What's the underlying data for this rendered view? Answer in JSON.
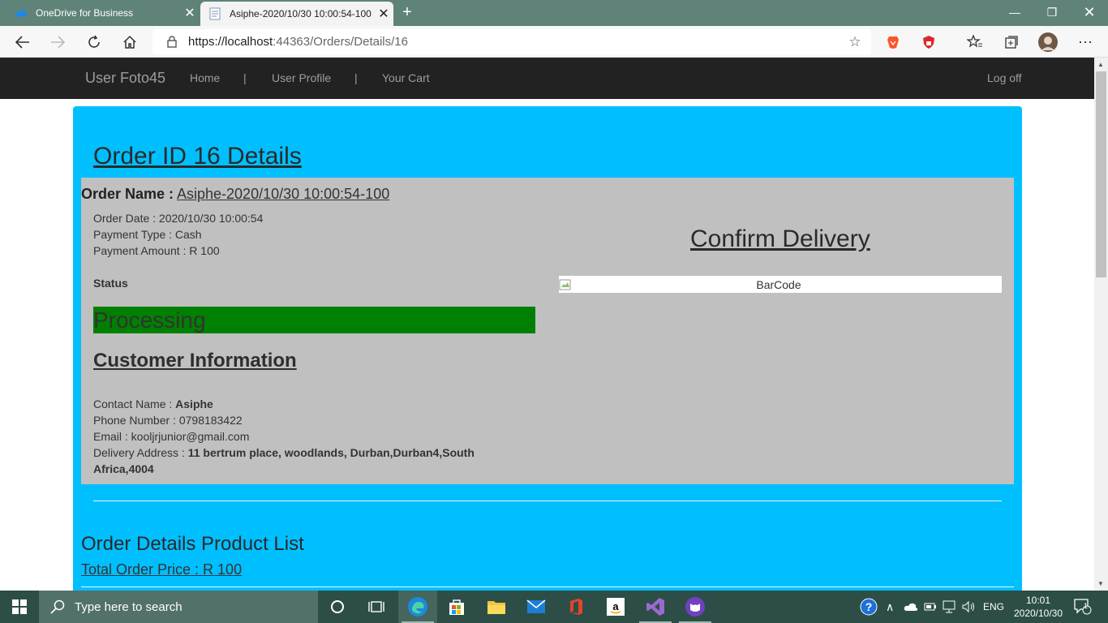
{
  "browser": {
    "tabs": [
      {
        "label": "OneDrive for Business",
        "active": false
      },
      {
        "label": "Asiphe-2020/10/30 10:00:54-100",
        "active": true
      }
    ],
    "url_prefix": "https://localhost",
    "url_rest": ":44363/Orders/Details/16"
  },
  "site_nav": {
    "brand": "User Foto45",
    "home": "Home",
    "sep1": "|",
    "profile": "User Profile",
    "sep2": "|",
    "cart": "Your Cart",
    "logoff": "Log off"
  },
  "order": {
    "title": "Order ID 16 Details",
    "name_label": "Order Name :",
    "name_value": "Asiphe-2020/10/30 10:00:54-100",
    "date": "Order Date : 2020/10/30 10:00:54",
    "payment_type": "Payment Type : Cash",
    "payment_amount": "Payment Amount : R 100",
    "status_label": "Status",
    "status_value": "Processing",
    "confirm_delivery": "Confirm Delivery",
    "barcode_alt": "BarCode"
  },
  "customer": {
    "title": "Customer Information",
    "contact_label": "Contact Name : ",
    "contact_value": "Asiphe",
    "phone": "Phone Number : 0798183422",
    "email": "Email : kooljrjunior@gmail.com",
    "address_label": "Delivery Address : ",
    "address_line1": "11 bertrum place, woodlands, Durban,Durban4,South",
    "address_line2": "Africa,4004"
  },
  "products": {
    "title": "Order Details Product List",
    "total": "Total Order Price : R 100"
  },
  "taskbar": {
    "search_placeholder": "Type here to search",
    "lang": "ENG",
    "time": "10:01",
    "date": "2020/10/30",
    "notification_count": "1"
  },
  "colors": {
    "panel": "#00bfff",
    "status_bar": "#008000",
    "navbar": "#222222",
    "gray_box": "#c0c0c0"
  }
}
